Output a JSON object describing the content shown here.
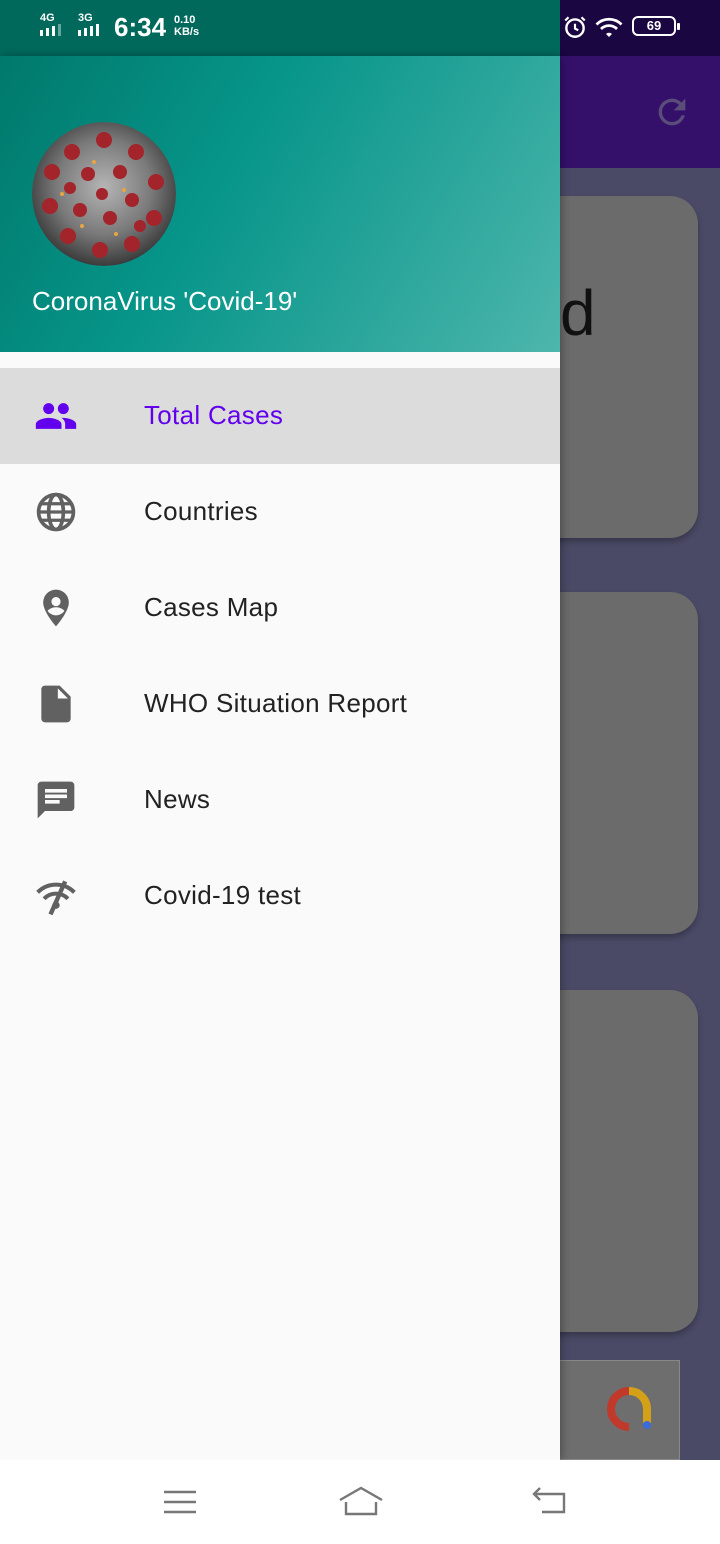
{
  "status_bar": {
    "signal1": "4G",
    "signal2": "3G",
    "time": "6:34",
    "speed_value": "0.10",
    "speed_unit": "KB/s",
    "battery": "69"
  },
  "background": {
    "card_text": "d"
  },
  "drawer": {
    "header_title": "CoronaVirus 'Covid-19'",
    "items": [
      {
        "label": "Total Cases",
        "icon": "people-icon",
        "active": true
      },
      {
        "label": "Countries",
        "icon": "globe-icon",
        "active": false
      },
      {
        "label": "Cases Map",
        "icon": "location-pin-icon",
        "active": false
      },
      {
        "label": "WHO Situation Report",
        "icon": "document-icon",
        "active": false
      },
      {
        "label": "News",
        "icon": "message-icon",
        "active": false
      },
      {
        "label": "Covid-19 test",
        "icon": "signal-off-icon",
        "active": false
      }
    ]
  },
  "colors": {
    "header_gradient_start": "#00796b",
    "header_gradient_end": "#4db6ac",
    "active_label": "#6200ee",
    "active_bg": "#dcdcdc",
    "icon": "#616161"
  }
}
